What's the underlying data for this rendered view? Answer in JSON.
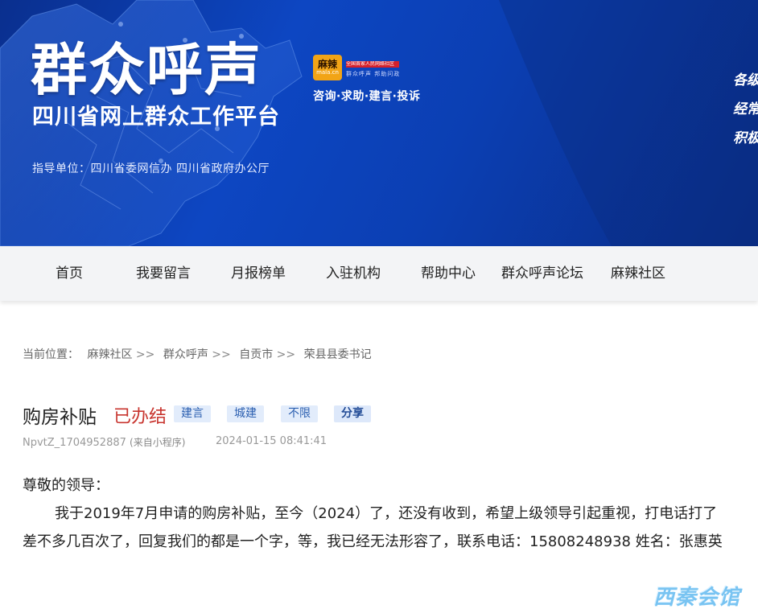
{
  "banner": {
    "title": "群众呼声",
    "subtitle": "四川省网上群众工作平台",
    "guide": "指导单位：四川省委网信办  四川省政府办公厅",
    "logo_main": "麻辣",
    "logo_sub": "mala.cn",
    "logo_red_text": "全国首家人民网络社区",
    "logo_slogan": "群众呼声  邦助问政",
    "services": "咨询·求助·建言·投诉",
    "right_lines": [
      "各级",
      "经常",
      "积极"
    ],
    "colors": {
      "bg_start": "#0a2f8e",
      "bg_mid": "#0d46c2",
      "logo": "#f2a416",
      "logo_red": "#d3212b"
    }
  },
  "nav": {
    "items": [
      "首页",
      "我要留言",
      "月报榜单",
      "入驻机构",
      "帮助中心",
      "群众呼声论坛",
      "麻辣社区"
    ]
  },
  "breadcrumb": {
    "label": "当前位置：",
    "items": [
      "麻辣社区",
      "群众呼声",
      "自贡市",
      "荣县县委书记"
    ],
    "separator": ">>"
  },
  "post": {
    "title": "购房补贴",
    "status": "已办结",
    "status_color": "#c8352f",
    "tags": [
      "建言",
      "城建",
      "不限"
    ],
    "share_label": "分享",
    "author": "NpvtZ_1704952887",
    "source": "(来自小程序)",
    "time": "2024-01-15 08:41:41",
    "greeting": "尊敬的领导：",
    "content": "我于2019年7月申请的购房补贴，至今（2024）了，还没有收到，希望上级领导引起重视，打电话打了差不多几百次了，回复我们的都是一个字，等，我已经无法形容了，联系电话：15808248938    姓名：张惠英"
  },
  "watermark": "西秦会馆"
}
